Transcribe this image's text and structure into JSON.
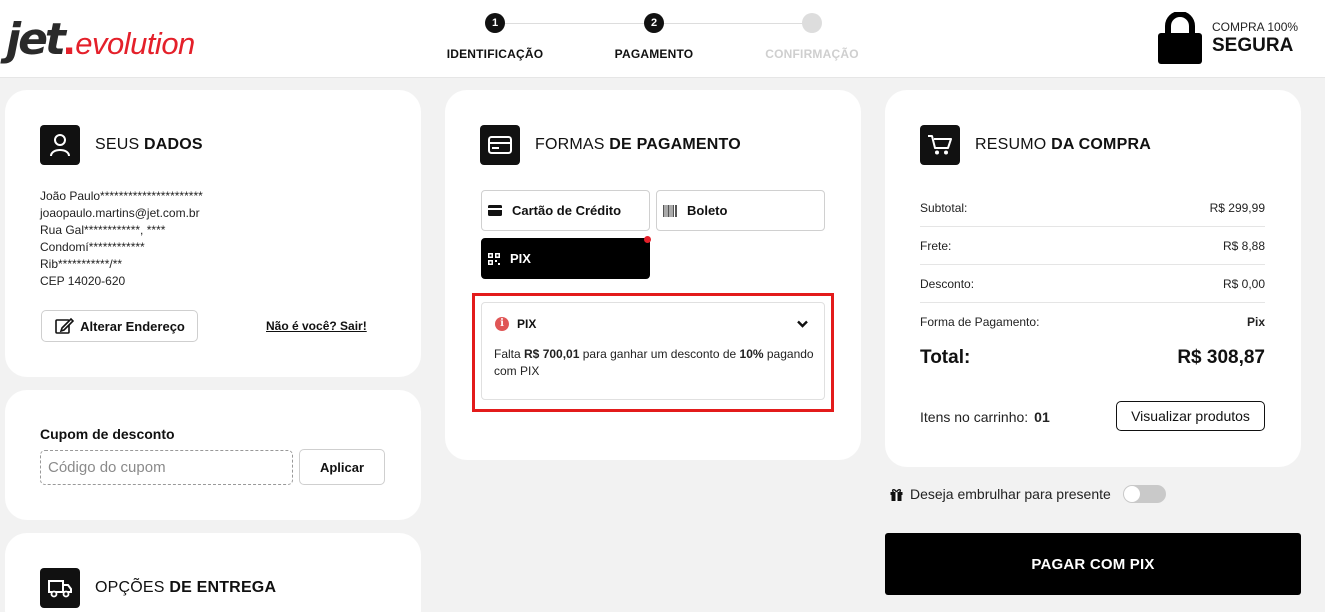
{
  "brand": {
    "logo_jet": "jet",
    "logo_dot": ".",
    "logo_evolution": "evolution",
    "red": "#e4202a"
  },
  "steps": [
    {
      "number": "1",
      "label": "IDENTIFICAÇÃO",
      "state": "done"
    },
    {
      "number": "2",
      "label": "PAGAMENTO",
      "state": "active"
    },
    {
      "number": "",
      "label": "CONFIRMAÇÃO",
      "state": "pending"
    }
  ],
  "secure": {
    "small": "COMPRA 100%",
    "big": "SEGURA",
    "icon": "lock-icon"
  },
  "user_card": {
    "title_light": "SEUS ",
    "title_bold": "DADOS",
    "lines": [
      "João Paulo**********************",
      "joaopaulo.martins@jet.com.br",
      "Rua Gal************, ****",
      "Condomí************",
      "Rib***********/**",
      "CEP 14020-620"
    ],
    "change_address": "Alterar Endereço",
    "not_you": "Não é você? Sair!"
  },
  "coupon": {
    "label": "Cupom de desconto",
    "placeholder": "Código do cupom",
    "value": "",
    "apply": "Aplicar"
  },
  "delivery": {
    "title_light": "OPÇÕES ",
    "title_bold": "DE ENTREGA"
  },
  "payment": {
    "title_light": "FORMAS ",
    "title_bold": "DE PAGAMENTO",
    "options": [
      {
        "label": "Cartão de Crédito",
        "icon": "credit-card-icon",
        "selected": false
      },
      {
        "label": "Boleto",
        "icon": "barcode-icon",
        "selected": false
      },
      {
        "label": "PIX",
        "icon": "qr-code-icon",
        "selected": true
      }
    ],
    "pix_box": {
      "title": "PIX",
      "msg_1": "Falta ",
      "msg_amount": "R$ 700,01",
      "msg_2": " para ganhar um desconto de ",
      "msg_pct": "10%",
      "msg_3": " pagando com PIX"
    }
  },
  "summary": {
    "title_light": "RESUMO ",
    "title_bold": "DA COMPRA",
    "rows": [
      {
        "label": "Subtotal:",
        "value": "R$ 299,99"
      },
      {
        "label": "Frete:",
        "value": "R$ 8,88"
      },
      {
        "label": "Desconto:",
        "value": "R$ 0,00"
      },
      {
        "label": "Forma de Pagamento:",
        "value": "Pix"
      }
    ],
    "total_label": "Total:",
    "total_value": "R$ 308,87",
    "items_label": "Itens no carrinho:",
    "items_count": "01",
    "view_products": "Visualizar produtos"
  },
  "gift": {
    "label": "Deseja embrulhar para presente",
    "enabled": false
  },
  "pay_button": "PAGAR COM PIX",
  "colors": {
    "highlight": "#e31b1b",
    "black": "#000000",
    "background": "#f2f2f2"
  }
}
